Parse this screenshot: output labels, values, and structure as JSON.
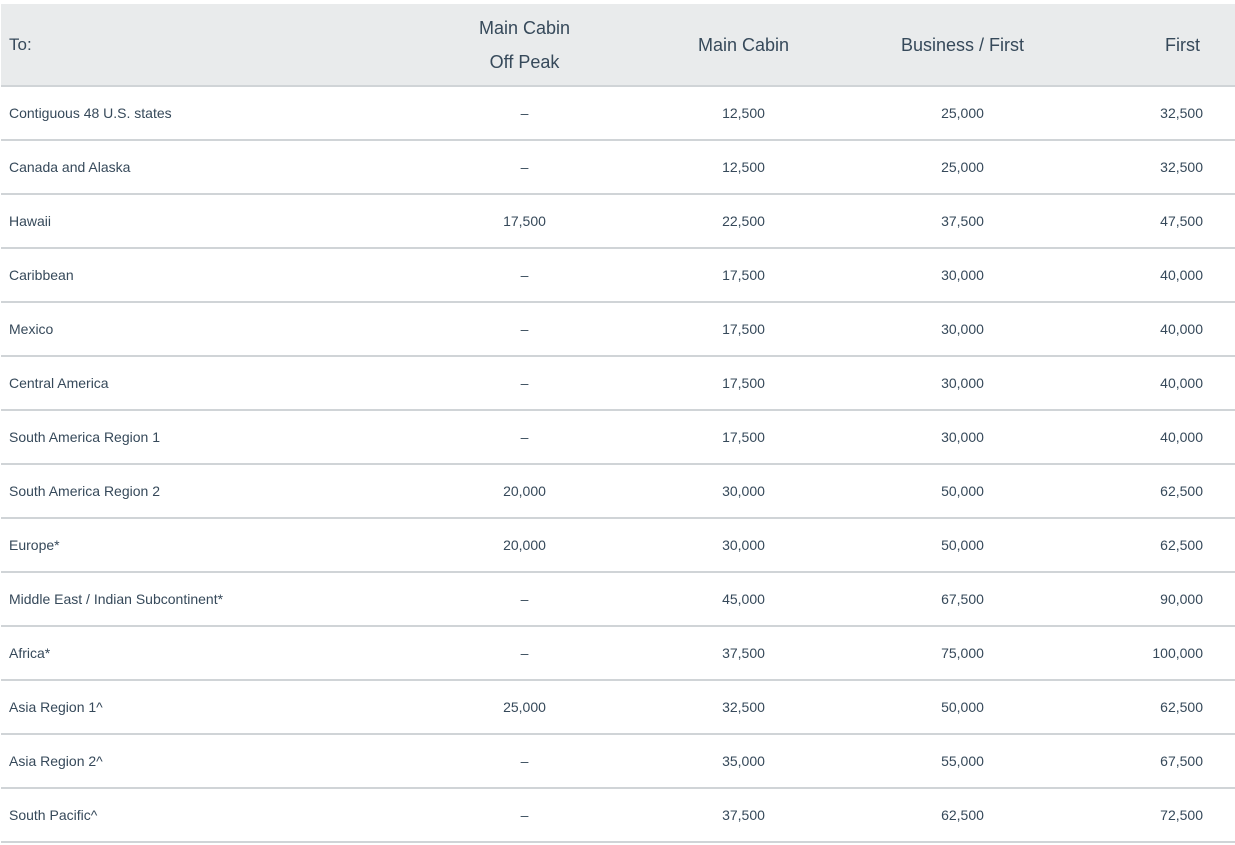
{
  "table": {
    "headers": {
      "destination": "To:",
      "off_peak_line1": "Main Cabin",
      "off_peak_line2": "Off Peak",
      "main_cabin": "Main Cabin",
      "business_first": "Business / First",
      "first": "First"
    },
    "rows": [
      {
        "destination": "Contiguous 48 U.S. states",
        "off_peak": "–",
        "main_cabin": "12,500",
        "business_first": "25,000",
        "first": "32,500"
      },
      {
        "destination": "Canada and Alaska",
        "off_peak": "–",
        "main_cabin": "12,500",
        "business_first": "25,000",
        "first": "32,500"
      },
      {
        "destination": "Hawaii",
        "off_peak": "17,500",
        "main_cabin": "22,500",
        "business_first": "37,500",
        "first": "47,500"
      },
      {
        "destination": "Caribbean",
        "off_peak": "–",
        "main_cabin": "17,500",
        "business_first": "30,000",
        "first": "40,000"
      },
      {
        "destination": "Mexico",
        "off_peak": "–",
        "main_cabin": "17,500",
        "business_first": "30,000",
        "first": "40,000"
      },
      {
        "destination": "Central America",
        "off_peak": "–",
        "main_cabin": "17,500",
        "business_first": "30,000",
        "first": "40,000"
      },
      {
        "destination": "South America Region 1",
        "off_peak": "–",
        "main_cabin": "17,500",
        "business_first": "30,000",
        "first": "40,000"
      },
      {
        "destination": "South America Region 2",
        "off_peak": "20,000",
        "main_cabin": "30,000",
        "business_first": "50,000",
        "first": "62,500"
      },
      {
        "destination": "Europe*",
        "off_peak": "20,000",
        "main_cabin": "30,000",
        "business_first": "50,000",
        "first": "62,500"
      },
      {
        "destination": "Middle East / Indian Subcontinent*",
        "off_peak": "–",
        "main_cabin": "45,000",
        "business_first": "67,500",
        "first": "90,000"
      },
      {
        "destination": "Africa*",
        "off_peak": "–",
        "main_cabin": "37,500",
        "business_first": "75,000",
        "first": "100,000"
      },
      {
        "destination": "Asia Region 1^",
        "off_peak": "25,000",
        "main_cabin": "32,500",
        "business_first": "50,000",
        "first": "62,500"
      },
      {
        "destination": "Asia Region 2^",
        "off_peak": "–",
        "main_cabin": "35,000",
        "business_first": "55,000",
        "first": "67,500"
      },
      {
        "destination": "South Pacific^",
        "off_peak": "–",
        "main_cabin": "37,500",
        "business_first": "62,500",
        "first": "72,500"
      }
    ]
  }
}
